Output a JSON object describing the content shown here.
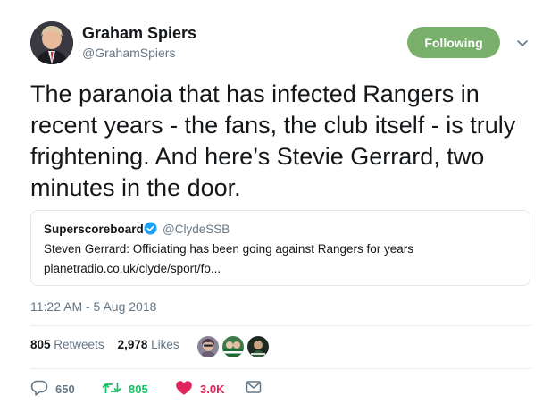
{
  "author": {
    "name": "Graham Spiers",
    "handle": "@GrahamSpiers",
    "follow_label": "Following"
  },
  "tweet": {
    "text": "The paranoia that has infected Rangers in\nrecent years - the fans, the club itself - is truly\nfrightening. And here’s Stevie Gerrard, two\nminutes in the door."
  },
  "quoted": {
    "name": "Superscoreboard",
    "handle": "@ClydeSSB",
    "text": "Steven Gerrard: Officiating has been going against Rangers for years",
    "link": "planetradio.co.uk/clyde/sport/fo..."
  },
  "timestamp": "11:22 AM - 5 Aug 2018",
  "stats": {
    "retweets_count": "805",
    "retweets_label": "Retweets",
    "likes_count": "2,978",
    "likes_label": "Likes"
  },
  "actions": {
    "reply_count": "650",
    "retweet_count": "805",
    "like_count": "3.0K"
  },
  "icons": {
    "reply": "reply-icon",
    "retweet": "retweet-icon",
    "like": "heart-icon",
    "dm": "envelope-icon",
    "verified": "verified-badge-icon",
    "caret": "chevron-down-icon"
  },
  "colors": {
    "following_button": "#79b06c",
    "retweet_green": "#17bf63",
    "like_red": "#e0245e",
    "secondary_text": "#657786",
    "verified_blue": "#1da1f2"
  }
}
